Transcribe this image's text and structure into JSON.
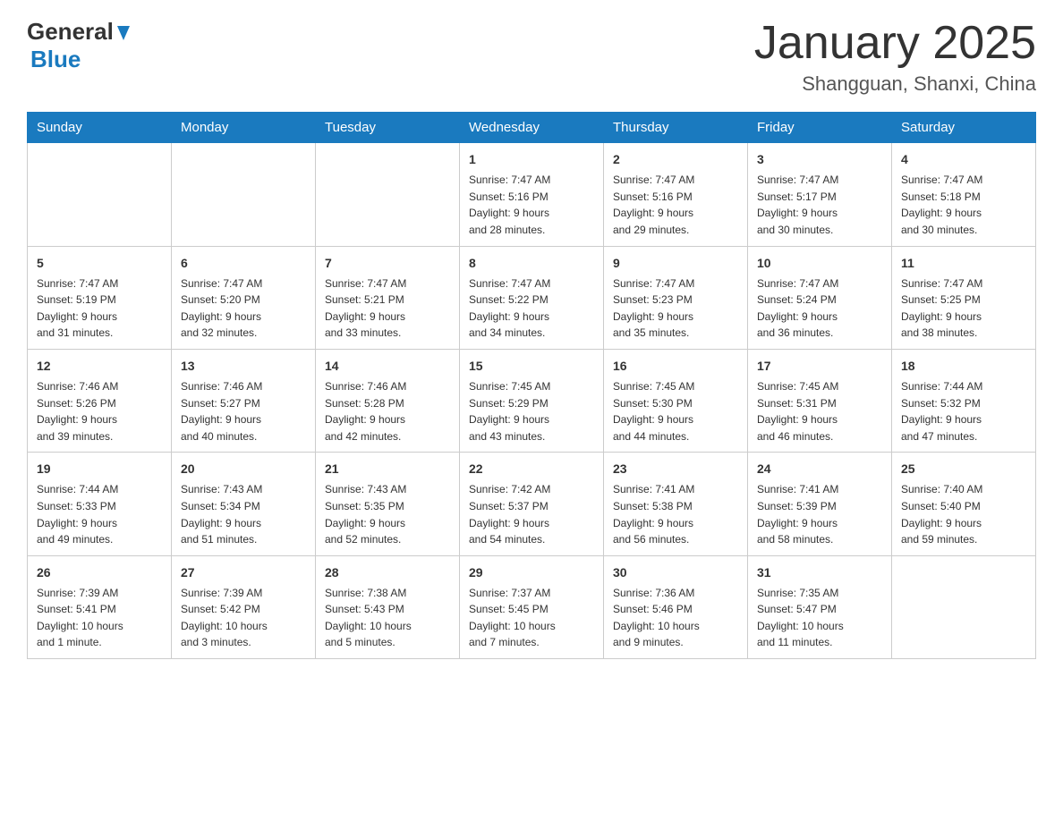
{
  "header": {
    "logo_general": "General",
    "logo_blue": "Blue",
    "title": "January 2025",
    "subtitle": "Shangguan, Shanxi, China"
  },
  "days_of_week": [
    "Sunday",
    "Monday",
    "Tuesday",
    "Wednesday",
    "Thursday",
    "Friday",
    "Saturday"
  ],
  "weeks": [
    [
      {
        "day": "",
        "info": ""
      },
      {
        "day": "",
        "info": ""
      },
      {
        "day": "",
        "info": ""
      },
      {
        "day": "1",
        "info": "Sunrise: 7:47 AM\nSunset: 5:16 PM\nDaylight: 9 hours\nand 28 minutes."
      },
      {
        "day": "2",
        "info": "Sunrise: 7:47 AM\nSunset: 5:16 PM\nDaylight: 9 hours\nand 29 minutes."
      },
      {
        "day": "3",
        "info": "Sunrise: 7:47 AM\nSunset: 5:17 PM\nDaylight: 9 hours\nand 30 minutes."
      },
      {
        "day": "4",
        "info": "Sunrise: 7:47 AM\nSunset: 5:18 PM\nDaylight: 9 hours\nand 30 minutes."
      }
    ],
    [
      {
        "day": "5",
        "info": "Sunrise: 7:47 AM\nSunset: 5:19 PM\nDaylight: 9 hours\nand 31 minutes."
      },
      {
        "day": "6",
        "info": "Sunrise: 7:47 AM\nSunset: 5:20 PM\nDaylight: 9 hours\nand 32 minutes."
      },
      {
        "day": "7",
        "info": "Sunrise: 7:47 AM\nSunset: 5:21 PM\nDaylight: 9 hours\nand 33 minutes."
      },
      {
        "day": "8",
        "info": "Sunrise: 7:47 AM\nSunset: 5:22 PM\nDaylight: 9 hours\nand 34 minutes."
      },
      {
        "day": "9",
        "info": "Sunrise: 7:47 AM\nSunset: 5:23 PM\nDaylight: 9 hours\nand 35 minutes."
      },
      {
        "day": "10",
        "info": "Sunrise: 7:47 AM\nSunset: 5:24 PM\nDaylight: 9 hours\nand 36 minutes."
      },
      {
        "day": "11",
        "info": "Sunrise: 7:47 AM\nSunset: 5:25 PM\nDaylight: 9 hours\nand 38 minutes."
      }
    ],
    [
      {
        "day": "12",
        "info": "Sunrise: 7:46 AM\nSunset: 5:26 PM\nDaylight: 9 hours\nand 39 minutes."
      },
      {
        "day": "13",
        "info": "Sunrise: 7:46 AM\nSunset: 5:27 PM\nDaylight: 9 hours\nand 40 minutes."
      },
      {
        "day": "14",
        "info": "Sunrise: 7:46 AM\nSunset: 5:28 PM\nDaylight: 9 hours\nand 42 minutes."
      },
      {
        "day": "15",
        "info": "Sunrise: 7:45 AM\nSunset: 5:29 PM\nDaylight: 9 hours\nand 43 minutes."
      },
      {
        "day": "16",
        "info": "Sunrise: 7:45 AM\nSunset: 5:30 PM\nDaylight: 9 hours\nand 44 minutes."
      },
      {
        "day": "17",
        "info": "Sunrise: 7:45 AM\nSunset: 5:31 PM\nDaylight: 9 hours\nand 46 minutes."
      },
      {
        "day": "18",
        "info": "Sunrise: 7:44 AM\nSunset: 5:32 PM\nDaylight: 9 hours\nand 47 minutes."
      }
    ],
    [
      {
        "day": "19",
        "info": "Sunrise: 7:44 AM\nSunset: 5:33 PM\nDaylight: 9 hours\nand 49 minutes."
      },
      {
        "day": "20",
        "info": "Sunrise: 7:43 AM\nSunset: 5:34 PM\nDaylight: 9 hours\nand 51 minutes."
      },
      {
        "day": "21",
        "info": "Sunrise: 7:43 AM\nSunset: 5:35 PM\nDaylight: 9 hours\nand 52 minutes."
      },
      {
        "day": "22",
        "info": "Sunrise: 7:42 AM\nSunset: 5:37 PM\nDaylight: 9 hours\nand 54 minutes."
      },
      {
        "day": "23",
        "info": "Sunrise: 7:41 AM\nSunset: 5:38 PM\nDaylight: 9 hours\nand 56 minutes."
      },
      {
        "day": "24",
        "info": "Sunrise: 7:41 AM\nSunset: 5:39 PM\nDaylight: 9 hours\nand 58 minutes."
      },
      {
        "day": "25",
        "info": "Sunrise: 7:40 AM\nSunset: 5:40 PM\nDaylight: 9 hours\nand 59 minutes."
      }
    ],
    [
      {
        "day": "26",
        "info": "Sunrise: 7:39 AM\nSunset: 5:41 PM\nDaylight: 10 hours\nand 1 minute."
      },
      {
        "day": "27",
        "info": "Sunrise: 7:39 AM\nSunset: 5:42 PM\nDaylight: 10 hours\nand 3 minutes."
      },
      {
        "day": "28",
        "info": "Sunrise: 7:38 AM\nSunset: 5:43 PM\nDaylight: 10 hours\nand 5 minutes."
      },
      {
        "day": "29",
        "info": "Sunrise: 7:37 AM\nSunset: 5:45 PM\nDaylight: 10 hours\nand 7 minutes."
      },
      {
        "day": "30",
        "info": "Sunrise: 7:36 AM\nSunset: 5:46 PM\nDaylight: 10 hours\nand 9 minutes."
      },
      {
        "day": "31",
        "info": "Sunrise: 7:35 AM\nSunset: 5:47 PM\nDaylight: 10 hours\nand 11 minutes."
      },
      {
        "day": "",
        "info": ""
      }
    ]
  ]
}
